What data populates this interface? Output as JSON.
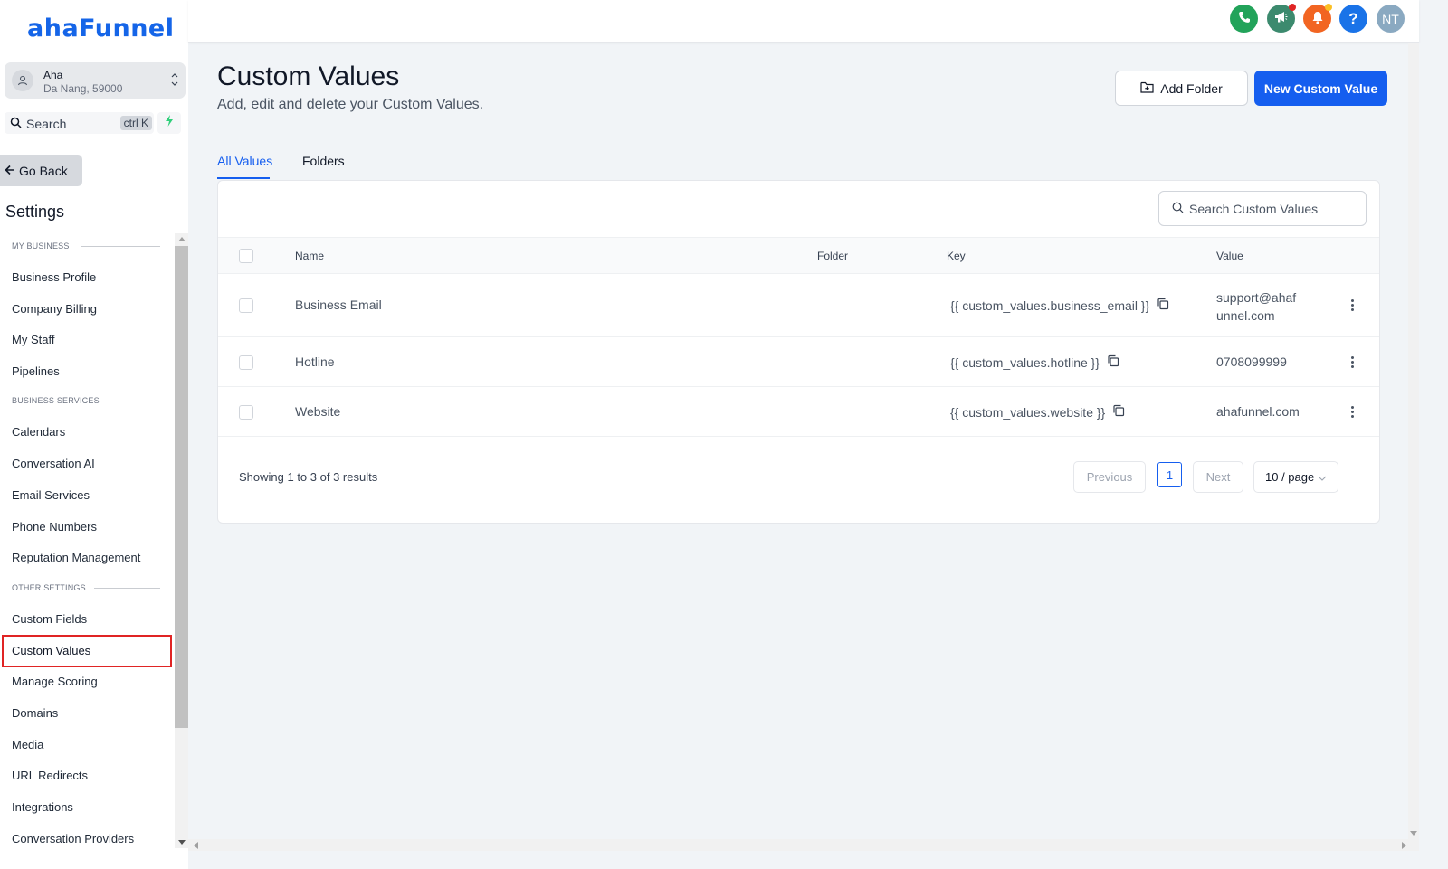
{
  "brand": {
    "logo_text": "ahaFunnel",
    "color": "#1565e8"
  },
  "account": {
    "name": "Aha",
    "location": "Da Nang, 59000"
  },
  "search": {
    "label": "Search",
    "shortcut": "ctrl K"
  },
  "go_back": "Go Back",
  "settings_title": "Settings",
  "sections": {
    "my_business": "MY BUSINESS",
    "business_services": "BUSINESS SERVICES",
    "other_settings": "OTHER SETTINGS"
  },
  "nav": {
    "business_profile": "Business Profile",
    "company_billing": "Company Billing",
    "my_staff": "My Staff",
    "pipelines": "Pipelines",
    "calendars": "Calendars",
    "conversation_ai": "Conversation AI",
    "email_services": "Email Services",
    "phone_numbers": "Phone Numbers",
    "reputation_management": "Reputation Management",
    "custom_fields": "Custom Fields",
    "custom_values": "Custom Values",
    "manage_scoring": "Manage Scoring",
    "domains": "Domains",
    "media": "Media",
    "url_redirects": "URL Redirects",
    "integrations": "Integrations",
    "conversation_providers": "Conversation Providers"
  },
  "topbar": {
    "icons": [
      "phone-icon",
      "megaphone-icon",
      "bell-icon",
      "help-icon"
    ],
    "avatar_initials": "NT",
    "colors": {
      "phone": "#22a35a",
      "megaphone": "#3c8a6e",
      "bell": "#f26522",
      "help": "#1a73e8",
      "avatar": "#8aa9c1"
    }
  },
  "page": {
    "title": "Custom Values",
    "subtitle": "Add, edit and delete your Custom Values.",
    "add_folder": "Add Folder",
    "new_custom_value": "New Custom Value",
    "accent": "#155eef"
  },
  "tabs": {
    "all_values": "All Values",
    "folders": "Folders"
  },
  "table": {
    "search_placeholder": "Search Custom Values",
    "headers": {
      "name": "Name",
      "folder": "Folder",
      "key": "Key",
      "value": "Value"
    },
    "rows": [
      {
        "name": "Business Email",
        "folder": "",
        "key": "{{ custom_values.business_email }}",
        "value_line1": "support@ahaf",
        "value_line2": "unnel.com"
      },
      {
        "name": "Hotline",
        "folder": "",
        "key": "{{ custom_values.hotline }}",
        "value": "0708099999"
      },
      {
        "name": "Website",
        "folder": "",
        "key": "{{ custom_values.website }}",
        "value": "ahafunnel.com"
      }
    ]
  },
  "pagination": {
    "showing": "Showing 1 to 3 of 3 results",
    "previous": "Previous",
    "current": "1",
    "next": "Next",
    "per_page": "10 / page"
  }
}
